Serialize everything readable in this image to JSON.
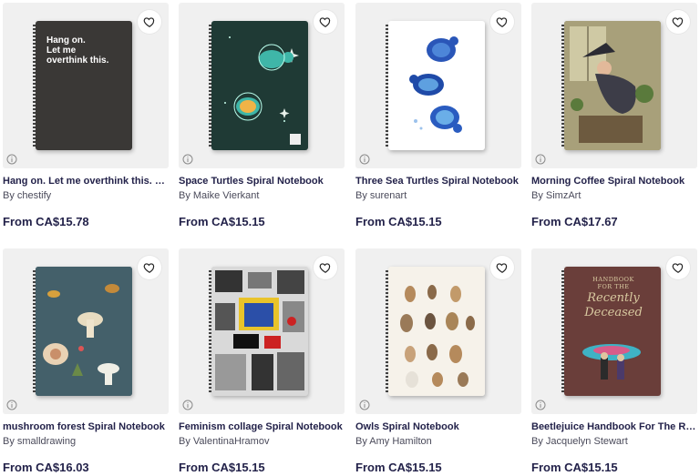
{
  "products": [
    {
      "title": "Hang on. Let me overthink this. Spiral Notebook",
      "artist": "By chestify",
      "price": "From CA$15.78",
      "cover_text": [
        "Hang on.",
        "Let me",
        "overthink this."
      ]
    },
    {
      "title": "Space Turtles Spiral Notebook",
      "artist": "By Maike Vierkant",
      "price": "From CA$15.15"
    },
    {
      "title": "Three Sea Turtles Spiral Notebook",
      "artist": "By surenart",
      "price": "From CA$15.15"
    },
    {
      "title": "Morning Coffee Spiral Notebook",
      "artist": "By SimzArt",
      "price": "From CA$17.67"
    },
    {
      "title": "mushroom forest Spiral Notebook",
      "artist": "By smalldrawing",
      "price": "From CA$16.03"
    },
    {
      "title": "Feminism collage Spiral Notebook",
      "artist": "By ValentinaHramov",
      "price": "From CA$15.15"
    },
    {
      "title": "Owls Spiral Notebook",
      "artist": "By Amy Hamilton",
      "price": "From CA$15.15"
    },
    {
      "title": "Beetlejuice Handbook For The Recently Deceased Spiral Notebook",
      "artist": "By Jacquelyn Stewart",
      "price": "From CA$15.15",
      "cover_text": [
        "HANDBOOK",
        "FOR THE",
        "Recently",
        "Deceased"
      ]
    }
  ],
  "icons": {
    "favorite": "heart-outline-icon",
    "info": "info-circle-icon"
  }
}
